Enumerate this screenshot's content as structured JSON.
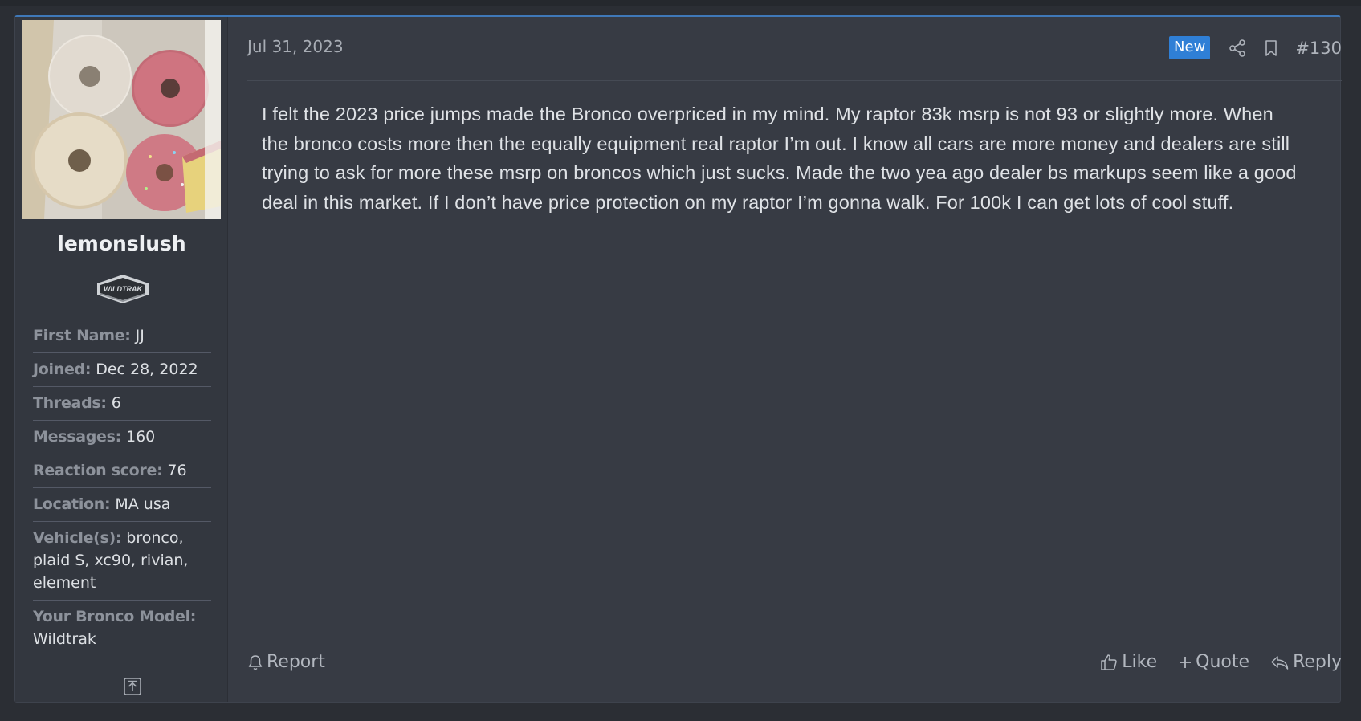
{
  "post": {
    "date": "Jul 31, 2023",
    "new_badge": "New",
    "post_number": "#130",
    "message": "I felt the 2023 price jumps made the Bronco overpriced in my mind. My raptor 83k msrp is not 93 or slightly more. When the bronco costs more then the equally equipment real raptor I’m out. I know all cars are more money and dealers are still trying to ask for more these msrp on broncos which just sucks. Made the two yea ago dealer bs markups seem like a good deal in this market. If I don’t have price protection on my raptor I’m gonna walk. For 100k I can get lots of cool stuff."
  },
  "user": {
    "username": "lemonslush",
    "badge_text": "WILDTRAK",
    "stats": [
      {
        "label": "First Name:",
        "value": "JJ"
      },
      {
        "label": "Joined:",
        "value": "Dec 28, 2022"
      },
      {
        "label": "Threads:",
        "value": "6"
      },
      {
        "label": "Messages:",
        "value": "160"
      },
      {
        "label": "Reaction score:",
        "value": "76"
      },
      {
        "label": "Location:",
        "value": "MA usa"
      },
      {
        "label": "Vehicle(s):",
        "value": "bronco, plaid S, xc90, rivian, element"
      },
      {
        "label": "Your Bronco Model:",
        "value": "Wildtrak"
      }
    ]
  },
  "actions": {
    "report": "Report",
    "like": "Like",
    "quote": "Quote",
    "reply": "Reply"
  },
  "icons": {
    "share": "share-icon",
    "bookmark": "bookmark-icon",
    "report": "bell-icon",
    "like": "thumbs-up-icon",
    "quote": "plus-icon",
    "reply": "reply-icon",
    "scroll_up": "arrow-up-box-icon"
  },
  "colors": {
    "accent": "#2f7fd6",
    "post_bg": "#373b44",
    "sidebar_bg": "#33373f"
  }
}
